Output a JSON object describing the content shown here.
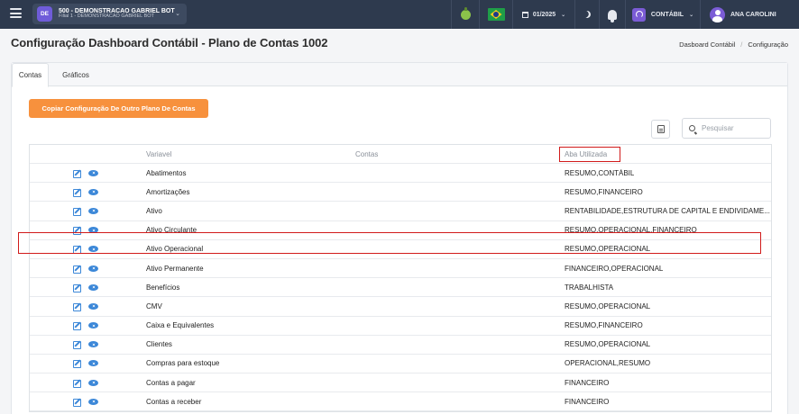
{
  "topbar": {
    "company_badge": "DE",
    "company_name": "500 - DEMONSTRACAO GABRIEL BOT",
    "company_branch": "Filial 1 - DEMONSTRACAO GABRIEL BOT",
    "period": "01/2025",
    "module": "CONTÁBIL",
    "user": "ANA CAROLINI"
  },
  "header": {
    "title": "Configuração Dashboard Contábil - Plano de Contas 1002",
    "breadcrumb": [
      "Dasboard Contábil",
      "Configuração"
    ],
    "breadcrumb_sep": "/"
  },
  "tabs": [
    "Contas",
    "Gráficos"
  ],
  "toolbar": {
    "copy_label": "Copiar Configuração De Outro Plano De Contas",
    "search_placeholder": "Pesquisar"
  },
  "table": {
    "columns": [
      "Variavel",
      "Contas",
      "Aba Utilizada"
    ],
    "rows": [
      {
        "variavel": "Abatimentos",
        "contas": "",
        "aba": "RESUMO,CONTÁBIL"
      },
      {
        "variavel": "Amortizações",
        "contas": "",
        "aba": "RESUMO,FINANCEIRO"
      },
      {
        "variavel": "Ativo",
        "contas": "",
        "aba": "RENTABILIDADE,ESTRUTURA DE CAPITAL E ENDIVIDAME..."
      },
      {
        "variavel": "Ativo Circulante",
        "contas": "",
        "aba": "RESUMO,OPERACIONAL,FINANCEIRO"
      },
      {
        "variavel": "Ativo Operacional",
        "contas": "",
        "aba": "RESUMO,OPERACIONAL"
      },
      {
        "variavel": "Ativo Permanente",
        "contas": "",
        "aba": "FINANCEIRO,OPERACIONAL"
      },
      {
        "variavel": "Benefícios",
        "contas": "",
        "aba": "TRABALHISTA"
      },
      {
        "variavel": "CMV",
        "contas": "",
        "aba": "RESUMO,OPERACIONAL"
      },
      {
        "variavel": "Caixa e Equivalentes",
        "contas": "",
        "aba": "RESUMO,FINANCEIRO"
      },
      {
        "variavel": "Clientes",
        "contas": "",
        "aba": "RESUMO,OPERACIONAL"
      },
      {
        "variavel": "Compras para estoque",
        "contas": "",
        "aba": "OPERACIONAL,RESUMO"
      },
      {
        "variavel": "Contas a pagar",
        "contas": "",
        "aba": "FINANCEIRO"
      },
      {
        "variavel": "Contas a receber",
        "contas": "",
        "aba": "FINANCEIRO"
      }
    ]
  },
  "colors": {
    "topbar": "#2e3a4e",
    "accent_orange": "#f7913d",
    "icon_blue": "#3b87d8",
    "highlight_red": "#d11b1b"
  }
}
